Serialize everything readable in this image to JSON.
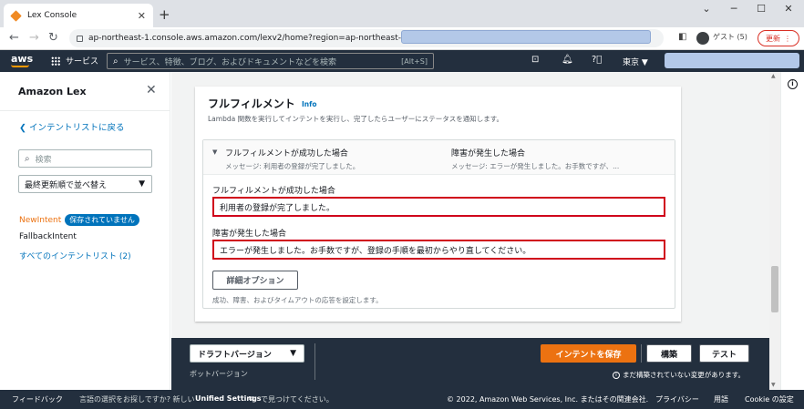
{
  "browser": {
    "tab_title": "Lex Console",
    "tab_close": "✕",
    "new_tab": "+",
    "url": "ap-northeast-1.console.aws.amazon.com/lexv2/home?region=ap-northeast-1#bot/",
    "guest_label": "ゲスト (5)",
    "update_label": "更新",
    "menu_glyph": "⋮"
  },
  "aws": {
    "logo": "aws",
    "services_label": "サービス",
    "search_placeholder": "サービス、特徴、ブログ、およびドキュメントなどを検索",
    "search_shortcut": "[Alt+S]",
    "region_label": "東京 ▼"
  },
  "sidebar": {
    "title": "Amazon Lex",
    "back_link": "インテントリストに戻る",
    "search_placeholder": "検索",
    "sort_label": "最終更新順で並べ替え",
    "items": [
      {
        "label": "NewIntent",
        "badge": "保存されていません"
      },
      {
        "label": "FallbackIntent"
      },
      {
        "label": "すべてのインテントリスト (2)"
      }
    ]
  },
  "fulfillment": {
    "title": "フルフィルメント",
    "info": "Info",
    "description": "Lambda 関数を実行してインテントを実行し、完了したらユーザーにステータスを通知します。",
    "success_header": "フルフィルメントが成功した場合",
    "success_summary": "メッセージ: 利用者の登録が完了しました。",
    "failure_header": "障害が発生した場合",
    "failure_summary": "メッセージ: エラーが発生しました。お手数ですが、...",
    "success_label": "フルフィルメントが成功した場合",
    "success_value": "利用者の登録が完了しました。",
    "failure_label": "障害が発生した場合",
    "failure_value": "エラーが発生しました。お手数ですが、登録の手順を最初からやり直してください。",
    "advanced_button": "詳細オプション",
    "advanced_desc": "成功、障害、およびタイムアウトの応答を設定します。"
  },
  "actionbar": {
    "draft_label": "ドラフトバージョン",
    "draft_sub": "ボットバージョン",
    "save_label": "インテントを保存",
    "build_label": "構築",
    "test_label": "テスト",
    "unsaved_note": "まだ構築されていない変更があります。"
  },
  "footer": {
    "feedback": "フィードバック",
    "lang_prompt": "言語の選択をお探しですか? 新しい",
    "unified": "Unified Settings",
    "lang_suffix": "で見つけてください。",
    "copyright": "© 2022, Amazon Web Services, Inc. またはその関連会社.",
    "privacy": "プライバシー",
    "terms": "用語",
    "cookie": "Cookie の設定"
  },
  "colors": {
    "aws_nav": "#232f3e",
    "accent_orange": "#ec7211",
    "link_blue": "#0073bb",
    "highlight_red": "#d0021b"
  }
}
